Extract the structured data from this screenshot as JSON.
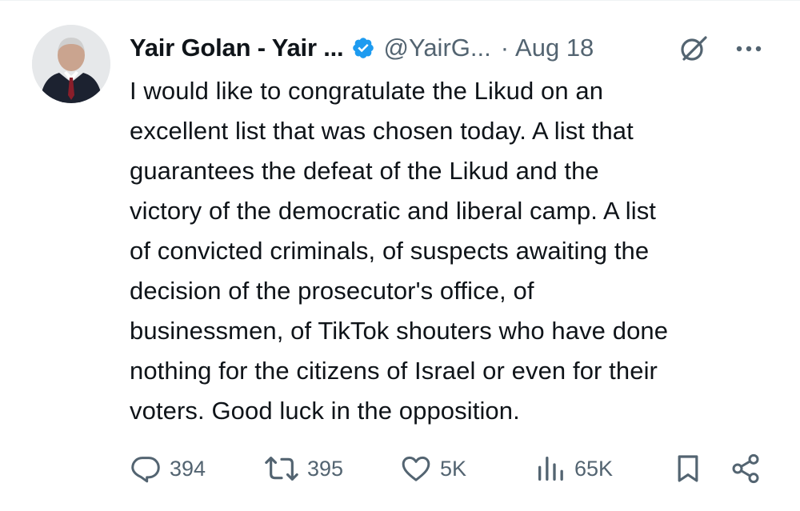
{
  "author": {
    "display_name": "Yair Golan - Yair ...",
    "handle": "@YairG...",
    "separator": "·",
    "date": "Aug 18",
    "avatar_icon": "profile-photo",
    "verified_color": "#1d9bf0"
  },
  "tweet": {
    "text": "I would like to congratulate the Likud on an\nexcellent list that was chosen today. A list that\nguarantees the defeat of the Likud and the\nvictory of the democratic and liberal camp. A list\nof convicted criminals, of suspects awaiting the\ndecision of the prosecutor's office, of\nbusinessmen, of TikTok shouters who have done\nnothing for the citizens of Israel or even for their\nvoters. Good luck in the opposition."
  },
  "actions": {
    "replies": "394",
    "reposts": "395",
    "likes": "5K",
    "views": "65K"
  },
  "icons": {
    "grok": "grok-icon",
    "more": "more-icon",
    "reply": "reply-icon",
    "repost": "repost-icon",
    "like": "heart-icon",
    "views": "views-icon",
    "bookmark": "bookmark-icon",
    "share": "share-icon"
  },
  "colors": {
    "text": "#0f1419",
    "secondary": "#536471",
    "accent": "#1d9bf0"
  }
}
